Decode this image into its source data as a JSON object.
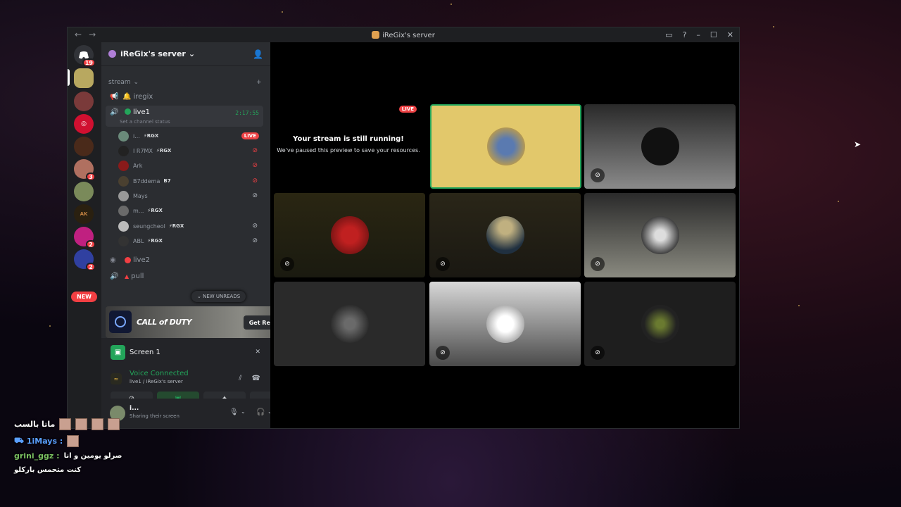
{
  "window": {
    "title": "iReGix's server"
  },
  "rail": {
    "dm_badge": "19",
    "badges": [
      "3",
      "2",
      "2"
    ],
    "new_label": "NEW"
  },
  "server": {
    "name": "iReGix's server"
  },
  "channels": {
    "category": "stream",
    "items": [
      {
        "name": "iregix"
      },
      {
        "name": "live1",
        "time": "2:17:55",
        "status": "Set a channel status"
      },
      {
        "name": "live2"
      },
      {
        "name": "pull"
      }
    ],
    "new_unreads": "NEW UNREADS"
  },
  "users": [
    {
      "name": "i...",
      "tag": "⚡RGX",
      "live": "LIVE"
    },
    {
      "name": "I R7MX",
      "tag": "⚡RGX"
    },
    {
      "name": "Ark",
      "tag": ""
    },
    {
      "name": "B7ddema",
      "tag": "B7"
    },
    {
      "name": "Mays",
      "tag": ""
    },
    {
      "name": "m...",
      "tag": "⚡RGX"
    },
    {
      "name": "seungcheol",
      "tag": "⚡RGX"
    },
    {
      "name": "ABL",
      "tag": "⚡RGX"
    }
  ],
  "promo": {
    "game": "CALL of DUTY",
    "button": "Get Reward!"
  },
  "screen": {
    "label": "Screen 1"
  },
  "voice": {
    "status": "Voice Connected",
    "location": "live1 / iReGix's server"
  },
  "user_panel": {
    "name": "i...",
    "status": "Sharing their screen"
  },
  "stage": {
    "live": "LIVE",
    "heading": "Your stream is still running!",
    "sub": "We've paused this preview to save your resources."
  },
  "chat": {
    "line1": "ماتا بالسب",
    "line2": "1iMays :",
    "line3_user": "grini_ggz :",
    "line3_text": "صرلو يومين و انا",
    "line4": "كنت متحمس باركلو"
  },
  "colors": {
    "accent_green": "#23a55a",
    "live_red": "#ed4245",
    "highlight_tile": "#e2c86b"
  }
}
